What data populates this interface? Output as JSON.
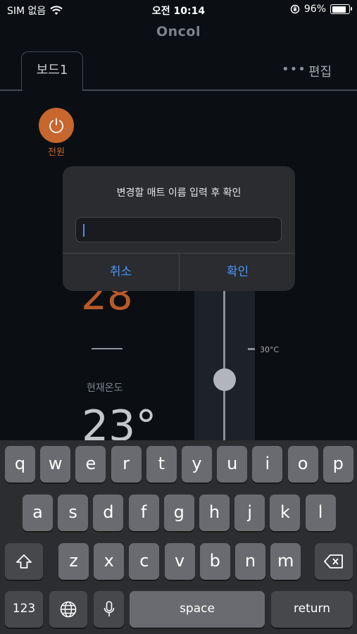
{
  "status_bar": {
    "carrier": "SIM 없음",
    "time": "오전 10:14",
    "battery_percent": "96%",
    "battery_level": 0.96
  },
  "header": {
    "logo": "Oncol",
    "tab_label": "보드1",
    "more_label": "•••",
    "edit_label": "편집"
  },
  "power": {
    "label": "전원"
  },
  "background": {
    "set_temp": "28",
    "current_label": "현재온도",
    "current_temp": "23°",
    "tick_label": "30°C"
  },
  "dialog": {
    "title": "변경할 매트 이름 입력 후 확인",
    "input_value": "",
    "cancel_label": "취소",
    "confirm_label": "확인"
  },
  "keyboard": {
    "row1": [
      "q",
      "w",
      "e",
      "r",
      "t",
      "y",
      "u",
      "i",
      "o",
      "p"
    ],
    "row2": [
      "a",
      "s",
      "d",
      "f",
      "g",
      "h",
      "j",
      "k",
      "l"
    ],
    "row3": [
      "z",
      "x",
      "c",
      "v",
      "b",
      "n",
      "m"
    ],
    "numbers_label": "123",
    "space_label": "space",
    "return_label": "return"
  }
}
